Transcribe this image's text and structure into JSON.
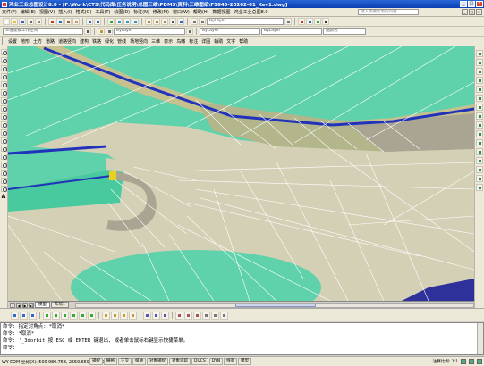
{
  "window": {
    "title": "鸿业工业总图设计8.0 - [F:\\Work\\CTS\\代码库\\任务说明\\总图三维\\PDMS\\资料\\三维图纸\\F5645-20202-01_Kev1.dwg]",
    "minimize": "_",
    "maximize": "□",
    "close": "×"
  },
  "menubar": {
    "items": [
      "文件(F)",
      "编辑(E)",
      "视图(V)",
      "插入(I)",
      "格式(O)",
      "工具(T)",
      "绘图(D)",
      "标注(N)",
      "修改(M)",
      "窗口(W)",
      "帮助(H)",
      "数据视图",
      "鸿业工业总图8.0"
    ],
    "help_placeholder": "键入需要帮助的问题"
  },
  "toolbar2": {
    "workspace": "三维建模工作空间",
    "layer_combo": "ByLayer",
    "linetype_combo": "ByLayer",
    "lineweight_combo": "ByLayer",
    "color_combo": "随颜色"
  },
  "cmdbar": {
    "items": [
      "设置",
      "地形",
      "土方",
      "道路",
      "道路竖向",
      "建构",
      "铁路",
      "绿化",
      "管线",
      "场地竖向",
      "三维",
      "表示",
      "鸟瞰",
      "标注",
      "详图",
      "辅助",
      "文字",
      "帮助"
    ]
  },
  "lefttb": {
    "letter_a": "A"
  },
  "tabs": {
    "model": "模型",
    "layout": "布局1",
    "nav": [
      "|◀",
      "◀",
      "▶",
      "▶|"
    ]
  },
  "command": {
    "lines": [
      "命令: 指定对角点: *取消*",
      "命令: *取消*",
      "命令: '_3dorbit 按 ESC 或 ENTER 键退出, 或者单击鼠标右键显示快捷菜单。",
      "命令:"
    ]
  },
  "status": {
    "coords": "WY-COM 坐标(X): 500 980.758, 2559.659, 0.000",
    "toggles": [
      "捕捉",
      "栅格",
      "正交",
      "极轴",
      "对象捕捉",
      "对象追踪",
      "DUCS",
      "DYN",
      "线宽",
      "模型"
    ],
    "scale_label": "注释比例: 1:1"
  },
  "colors": {
    "terrain_green": "#5fd2ab",
    "road_tan": "#d4d0b6",
    "embankment_olive": "#b3b58a",
    "shadow_gray": "#a9a592",
    "curb_blue": "#2233bb",
    "mesh_white": "#ffffff",
    "corner_purple": "#2d3199",
    "marker_yellow": "#e6d21d"
  }
}
